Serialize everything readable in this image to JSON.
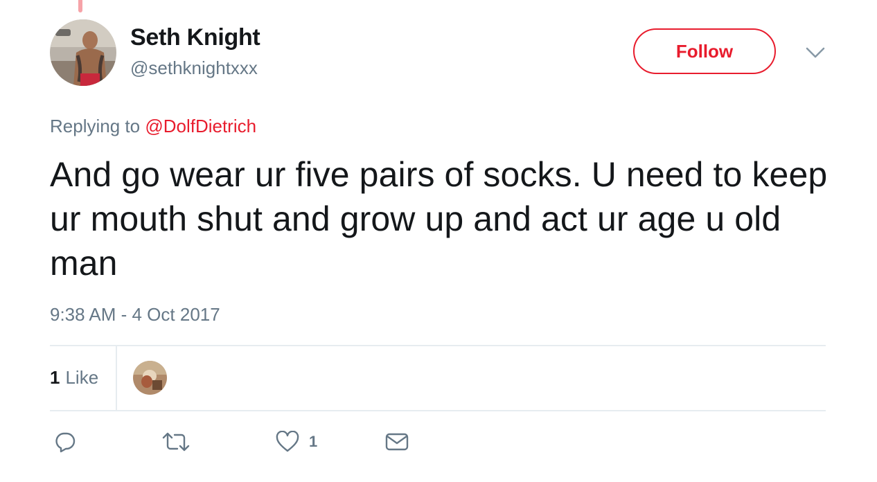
{
  "author": {
    "display_name": "Seth Knight",
    "handle": "@sethknightxxx"
  },
  "follow_button": {
    "label": "Follow"
  },
  "reply": {
    "prefix": "Replying to",
    "mention": "@DolfDietrich"
  },
  "tweet": {
    "text": "And go wear ur five pairs of socks. U need to keep ur mouth shut and grow up and act ur age u old man",
    "timestamp": "9:38 AM - 4 Oct 2017"
  },
  "stats": {
    "like_count": "1",
    "like_label": "Like"
  },
  "actions": {
    "reply_icon": "reply-icon",
    "retweet_icon": "retweet-icon",
    "like_icon": "heart-icon",
    "like_count": "1",
    "dm_icon": "envelope-icon"
  },
  "colors": {
    "accent": "#e81c2d",
    "muted": "#657786",
    "text": "#14171a",
    "divider": "#e6ecf0"
  }
}
